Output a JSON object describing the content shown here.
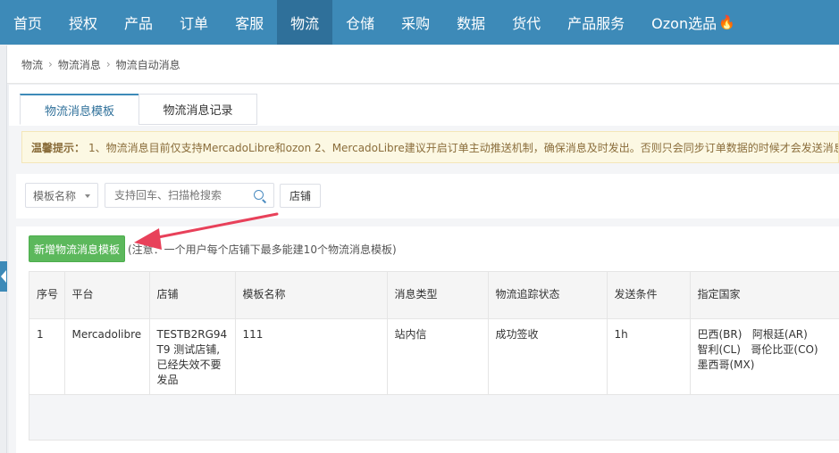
{
  "nav": {
    "items": [
      {
        "label": "首页"
      },
      {
        "label": "授权"
      },
      {
        "label": "产品"
      },
      {
        "label": "订单"
      },
      {
        "label": "客服"
      },
      {
        "label": "物流",
        "active": true
      },
      {
        "label": "仓储"
      },
      {
        "label": "采购"
      },
      {
        "label": "数据"
      },
      {
        "label": "货代"
      },
      {
        "label": "产品服务"
      },
      {
        "label": "Ozon选品",
        "icon": "fire-icon"
      }
    ],
    "active_color": "#2f709a",
    "bar_color": "#3d8ab8"
  },
  "breadcrumb": [
    "物流",
    "物流消息",
    "物流自动消息"
  ],
  "tabs": [
    {
      "label": "物流消息模板",
      "active": true
    },
    {
      "label": "物流消息记录"
    }
  ],
  "notice": {
    "label": "温馨提示：",
    "text": "1、物流消息目前仅支持MercadoLibre和ozon 2、MercadoLibre建议开启订单主动推送机制，确保消息及时发出。否则只会同步订单数据的时候才会发送消息"
  },
  "filters": {
    "template_select": "模板名称",
    "search_placeholder": "支持回车、扫描枪搜索",
    "search_value": "",
    "shop_button": "店铺"
  },
  "actions": {
    "add_button": "新增物流消息模板",
    "note": "(注意：一个用户每个店铺下最多能建10个物流消息模板)"
  },
  "table": {
    "headers": [
      "序号",
      "平台",
      "店铺",
      "模板名称",
      "消息类型",
      "物流追踪状态",
      "发送条件",
      "指定国家"
    ],
    "rows": [
      {
        "seq": "1",
        "platform": "Mercadolibre",
        "shop": "TESTB2RG94T9 测试店铺,已经失效不要发品",
        "template_name": "111",
        "message_type": "站内信",
        "tracking_status": "成功签收",
        "send_condition": "1h",
        "countries": [
          "巴西(BR)",
          "阿根廷(AR)",
          "智利(CL)",
          "哥伦比亚(CO)",
          "墨西哥(MX)"
        ]
      }
    ]
  },
  "colors": {
    "accent": "#3d8ab8",
    "add_button": "#5cb85c",
    "notice_bg": "#fcf8e3",
    "annotation_arrow": "#e8415a"
  }
}
